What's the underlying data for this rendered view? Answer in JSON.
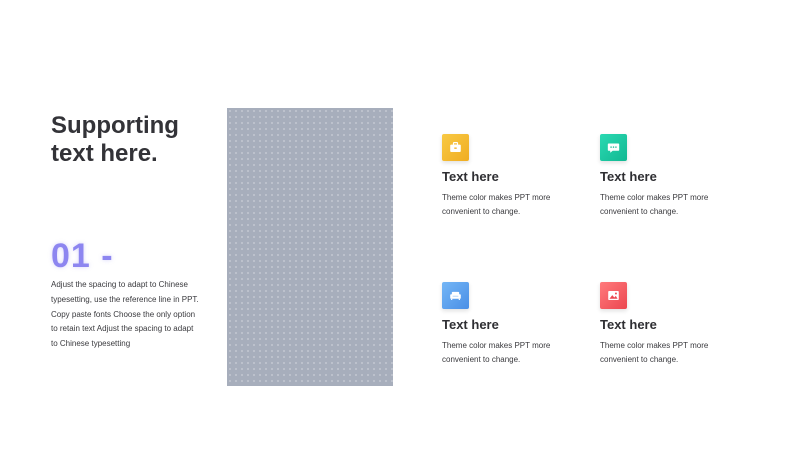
{
  "left": {
    "heading": "Supporting text here.",
    "number": "01 -",
    "body": "Adjust the spacing to adapt to Chinese typesetting, use the reference line in PPT. Copy paste fonts Choose the only option to retain text Adjust the spacing to adapt to Chinese typesetting"
  },
  "features": [
    {
      "icon": "briefcase-icon",
      "color": "#f2b22a",
      "title": "Text here",
      "desc": "Theme  color makes PPT more\nconvenient to change."
    },
    {
      "icon": "chat-bubble-icon",
      "color": "#19c6a2",
      "title": "Text here",
      "desc": "Theme  color makes PPT more\nconvenient to change."
    },
    {
      "icon": "sofa-icon",
      "color": "#5aa2ee",
      "title": "Text here",
      "desc": "Theme  color makes PPT more\nconvenient to change."
    },
    {
      "icon": "picture-icon",
      "color": "#f25a5f",
      "title": "Text here",
      "desc": "Theme  color makes PPT more\nconvenient to change."
    }
  ]
}
